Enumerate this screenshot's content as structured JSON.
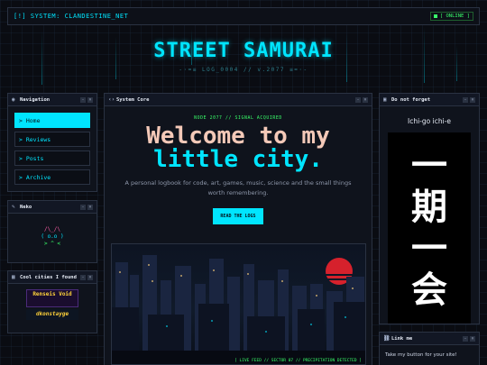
{
  "topbar": {
    "system": "[!] SYSTEM: CLANDESTINE_NET",
    "status": "[ ONLINE ]"
  },
  "header": {
    "title": "STREET SAMURAI",
    "subtitle": "-·=≡ LOG_0004 // v.2077 ≡=·-"
  },
  "navigation": {
    "title": "Navigation",
    "items": [
      {
        "label": "> Home",
        "active": true
      },
      {
        "label": "> Reviews",
        "active": false
      },
      {
        "label": "> Posts",
        "active": false
      },
      {
        "label": "> Archive",
        "active": false
      }
    ]
  },
  "neko": {
    "title": "Neko",
    "line1": "/\\_/\\",
    "line2": "( o.o )",
    "line3": "> ^ <"
  },
  "cities": {
    "title": "Cool cities I found",
    "logo1": "Renseis Void",
    "logo2": "dkonstayge"
  },
  "core": {
    "title": "System Core",
    "node": "NODE 2077 // SIGNAL ACQUIRED",
    "welcome_line1": "Welcome to my",
    "welcome_line2": "little city.",
    "description": "A personal logbook for code, art, games, music, science and the small things worth remembering.",
    "button": "READ THE LOGS",
    "city_caption": "[ LIVE FEED // SECTOR 07 // PRECIPITATION DETECTED ]"
  },
  "forget": {
    "title": "Do not forget",
    "phrase": "Ichi-go ichi-e",
    "kanji": [
      "一",
      "期",
      "一",
      "会"
    ]
  },
  "linkme": {
    "title": "Link me",
    "text": "Take my button for your site!"
  },
  "colors": {
    "accent": "#00e5ff",
    "green": "#39ff6a",
    "peach": "#f4c9b8",
    "bg": "#0a0c12"
  }
}
